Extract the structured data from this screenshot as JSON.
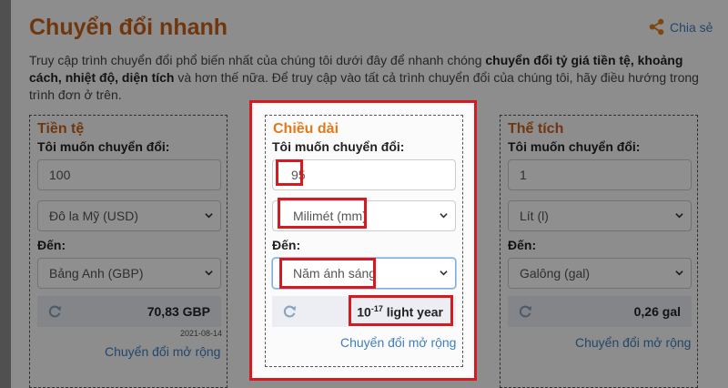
{
  "header": {
    "title": "Chuyển đổi nhanh",
    "share_label": "Chia sẻ"
  },
  "intro": {
    "part1": "Truy cập trình chuyển đổi phổ biến nhất của chúng tôi dưới đây để nhanh chóng ",
    "bold1": "chuyển đổi tỷ giá tiền tệ, khoảng cách, nhiệt độ, diện tích",
    "part2": " và hơn thế nữa. Để truy cập vào tất cả trình chuyển đổi của chúng tôi, hãy điều hướng trong trình đơn ở trên."
  },
  "cards": {
    "currency": {
      "title": "Tiền tệ",
      "want_label": "Tôi muốn chuyển đổi:",
      "value": "100",
      "from_unit": "Đô la Mỹ (USD)",
      "to_label": "Đến:",
      "to_unit": "Bảng Anh (GBP)",
      "result": "70,83 GBP",
      "date": "2021-08-14",
      "more_link": "Chuyển đổi mở rộng"
    },
    "length": {
      "title": "Chiều dài",
      "want_label": "Tôi muốn chuyển đổi:",
      "value": "95",
      "from_unit": "Milimét (mm)",
      "to_label": "Đến:",
      "to_unit": "Năm ánh sáng",
      "result_base": "10",
      "result_exp": "-17",
      "result_unit": " light year",
      "more_link": "Chuyển đổi mở rộng"
    },
    "volume": {
      "title": "Thể tích",
      "want_label": "Tôi muốn chuyển đổi:",
      "value": "1",
      "from_unit": "Lít (l)",
      "to_label": "Đến:",
      "to_unit": "Galông (gal)",
      "result": "0,26 gal",
      "more_link": "Chuyển đổi mở rộng"
    }
  },
  "colors": {
    "title_orange": "#c8631c",
    "link_blue": "#3d7fbf",
    "highlight_red": "#d71920"
  }
}
